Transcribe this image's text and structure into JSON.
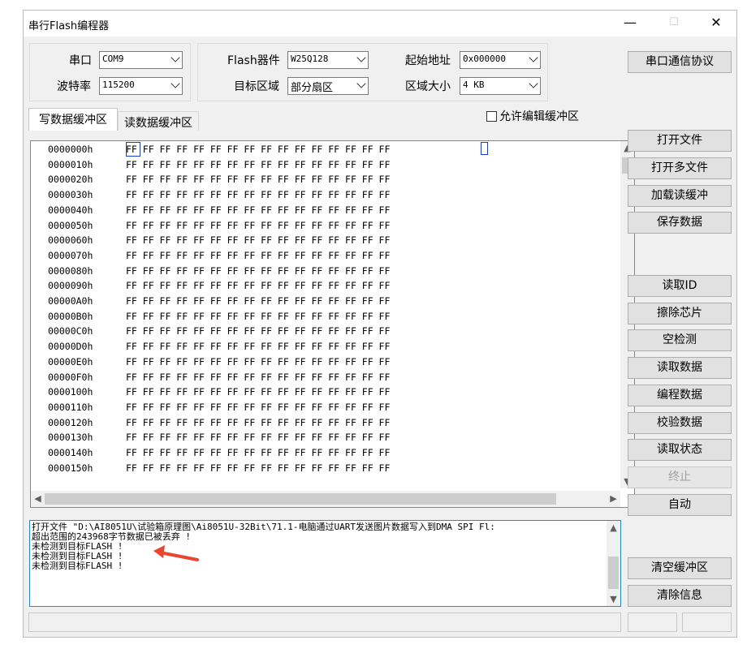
{
  "window": {
    "title": "串行Flash编程器",
    "minimize": "—",
    "maximize": "☐",
    "close": "✕"
  },
  "config": {
    "port_label": "串口",
    "port_value": "COM9",
    "baud_label": "波特率",
    "baud_value": "115200",
    "device_label": "Flash器件",
    "device_value": "W25Q128",
    "target_label": "目标区域",
    "target_value": "部分扇区",
    "start_label": "起始地址",
    "start_value": "0x000000",
    "size_label": "区域大小",
    "size_value": "4 KB",
    "protocol_button": "串口通信协议"
  },
  "tabs": {
    "write_buffer": "写数据缓冲区",
    "read_buffer": "读数据缓冲区",
    "allow_edit": "允许编辑缓冲区"
  },
  "hex": {
    "rows": [
      {
        "addr": "0000000h",
        "bytes": "FF FF FF FF FF FF FF FF FF FF FF FF FF FF FF FF"
      },
      {
        "addr": "0000010h",
        "bytes": "FF FF FF FF FF FF FF FF FF FF FF FF FF FF FF FF"
      },
      {
        "addr": "0000020h",
        "bytes": "FF FF FF FF FF FF FF FF FF FF FF FF FF FF FF FF"
      },
      {
        "addr": "0000030h",
        "bytes": "FF FF FF FF FF FF FF FF FF FF FF FF FF FF FF FF"
      },
      {
        "addr": "0000040h",
        "bytes": "FF FF FF FF FF FF FF FF FF FF FF FF FF FF FF FF"
      },
      {
        "addr": "0000050h",
        "bytes": "FF FF FF FF FF FF FF FF FF FF FF FF FF FF FF FF"
      },
      {
        "addr": "0000060h",
        "bytes": "FF FF FF FF FF FF FF FF FF FF FF FF FF FF FF FF"
      },
      {
        "addr": "0000070h",
        "bytes": "FF FF FF FF FF FF FF FF FF FF FF FF FF FF FF FF"
      },
      {
        "addr": "0000080h",
        "bytes": "FF FF FF FF FF FF FF FF FF FF FF FF FF FF FF FF"
      },
      {
        "addr": "0000090h",
        "bytes": "FF FF FF FF FF FF FF FF FF FF FF FF FF FF FF FF"
      },
      {
        "addr": "00000A0h",
        "bytes": "FF FF FF FF FF FF FF FF FF FF FF FF FF FF FF FF"
      },
      {
        "addr": "00000B0h",
        "bytes": "FF FF FF FF FF FF FF FF FF FF FF FF FF FF FF FF"
      },
      {
        "addr": "00000C0h",
        "bytes": "FF FF FF FF FF FF FF FF FF FF FF FF FF FF FF FF"
      },
      {
        "addr": "00000D0h",
        "bytes": "FF FF FF FF FF FF FF FF FF FF FF FF FF FF FF FF"
      },
      {
        "addr": "00000E0h",
        "bytes": "FF FF FF FF FF FF FF FF FF FF FF FF FF FF FF FF"
      },
      {
        "addr": "00000F0h",
        "bytes": "FF FF FF FF FF FF FF FF FF FF FF FF FF FF FF FF"
      },
      {
        "addr": "0000100h",
        "bytes": "FF FF FF FF FF FF FF FF FF FF FF FF FF FF FF FF"
      },
      {
        "addr": "0000110h",
        "bytes": "FF FF FF FF FF FF FF FF FF FF FF FF FF FF FF FF"
      },
      {
        "addr": "0000120h",
        "bytes": "FF FF FF FF FF FF FF FF FF FF FF FF FF FF FF FF"
      },
      {
        "addr": "0000130h",
        "bytes": "FF FF FF FF FF FF FF FF FF FF FF FF FF FF FF FF"
      },
      {
        "addr": "0000140h",
        "bytes": "FF FF FF FF FF FF FF FF FF FF FF FF FF FF FF FF"
      },
      {
        "addr": "0000150h",
        "bytes": "FF FF FF FF FF FF FF FF FF FF FF FF FF FF FF FF"
      }
    ]
  },
  "buttons": {
    "open_file": "打开文件",
    "open_multi": "打开多文件",
    "load_buffer": "加载读缓冲",
    "save_data": "保存数据",
    "read_id": "读取ID",
    "erase_chip": "擦除芯片",
    "blank_check": "空检测",
    "read_data": "读取数据",
    "program_data": "编程数据",
    "verify_data": "校验数据",
    "read_status": "读取状态",
    "stop": "终止",
    "auto": "自动",
    "clear_buffer": "清空缓冲区",
    "clear_info": "清除信息"
  },
  "log": {
    "lines": [
      "打开文件 \"D:\\AI8051U\\试验箱原理图\\Ai8051U-32Bit\\71.1-电脑通过UART发送图片数据写入到DMA SPI Fl:",
      "超出范围的243968字节数据已被丢弃 !",
      "未检测到目标FLASH !",
      "未检测到目标FLASH !",
      "未检测到目标FLASH !"
    ]
  },
  "colors": {
    "accent": "#1e88e5",
    "cursor": "#1a3ccf",
    "arrow": "#e8462e"
  }
}
